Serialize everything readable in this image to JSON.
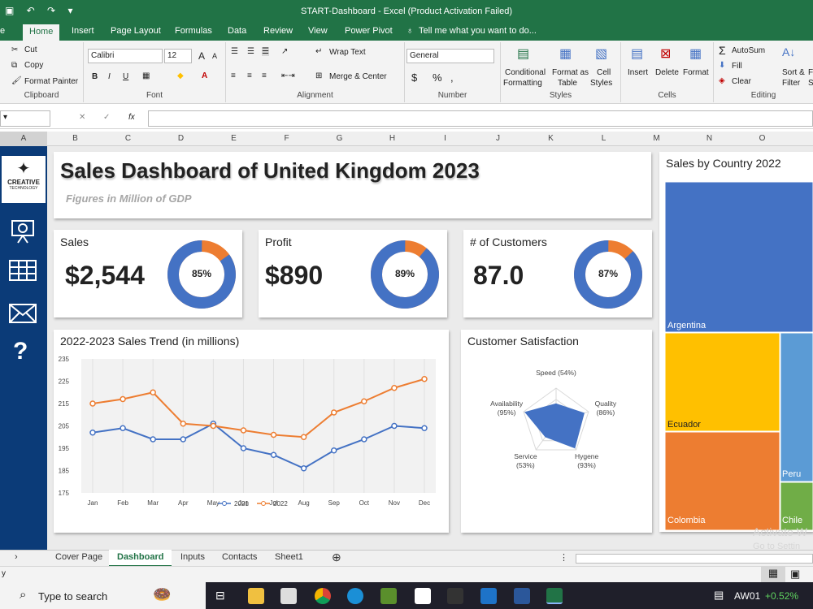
{
  "window": {
    "title": "START-Dashboard - Excel (Product Activation Failed)",
    "file_tab": "e"
  },
  "ribbon_tabs": [
    "Home",
    "Insert",
    "Page Layout",
    "Formulas",
    "Data",
    "Review",
    "View",
    "Power Pivot",
    "Tell me what you want to do..."
  ],
  "clipboard": {
    "cut": "Cut",
    "copy": "Copy",
    "format_painter": "Format Painter",
    "label": "Clipboard"
  },
  "font": {
    "name": "Calibri",
    "size": "12",
    "label": "Font",
    "bold": "B",
    "italic": "I",
    "underline": "U",
    "grow": "A",
    "shrink": "A"
  },
  "alignment": {
    "wrap": "Wrap Text",
    "merge": "Merge & Center",
    "label": "Alignment"
  },
  "number": {
    "format": "General",
    "currency": "$",
    "percent": "%",
    "comma": ",",
    "label": "Number"
  },
  "styles": {
    "conditional": "Conditional",
    "conditional2": "Formatting",
    "format_table": "Format as",
    "format_table2": "Table",
    "cell": "Cell",
    "cell2": "Styles",
    "label": "Styles"
  },
  "cells": {
    "insert": "Insert",
    "delete": "Delete",
    "format": "Format",
    "label": "Cells"
  },
  "editing": {
    "autosum": "AutoSum",
    "fill": "Fill",
    "clear": "Clear",
    "sort": "Sort &",
    "sort2": "Filter",
    "find": "F",
    "find2": "S",
    "label": "Editing"
  },
  "formula_bar": {
    "cancel": "✕",
    "enter": "✓",
    "fx": "fx",
    "value": ""
  },
  "columns": [
    "A",
    "B",
    "C",
    "D",
    "E",
    "F",
    "G",
    "H",
    "I",
    "J",
    "K",
    "L",
    "M",
    "N",
    "O"
  ],
  "logo": {
    "text": "CREATIVE",
    "sub": "TECHNOLOGY"
  },
  "dashboard": {
    "title": "Sales Dashboard of United Kingdom 2023",
    "subtitle": "Figures in Million of GDP"
  },
  "kpis": [
    {
      "label": "Sales",
      "value": "$2,544",
      "pct": "85%",
      "fraction": 0.85
    },
    {
      "label": "Profit",
      "value": "$890",
      "pct": "89%",
      "fraction": 0.89
    },
    {
      "label": "# of Customers",
      "value": "87.0",
      "pct": "87%",
      "fraction": 0.87
    }
  ],
  "colors": {
    "blue": "#4472c4",
    "orange": "#ed7d31",
    "yellow": "#ffc000",
    "sky": "#5b9bd5",
    "green": "#70ad47",
    "navy": "#0b3b78",
    "excel": "#217346"
  },
  "chart_data": [
    {
      "type": "line",
      "title": "2022-2023 Sales Trend (in millions)",
      "categories": [
        "Jan",
        "Feb",
        "Mar",
        "Apr",
        "May",
        "Jun",
        "Jul",
        "Aug",
        "Sep",
        "Oct",
        "Nov",
        "Dec"
      ],
      "series": [
        {
          "name": "2021",
          "values": [
            202,
            204,
            199,
            199,
            206,
            195,
            192,
            186,
            194,
            199,
            205,
            204
          ]
        },
        {
          "name": "2022",
          "values": [
            215,
            217,
            220,
            206,
            205,
            203,
            201,
            200,
            211,
            216,
            222,
            226
          ]
        }
      ],
      "yticks": [
        235,
        225,
        215,
        205,
        195,
        185,
        175
      ],
      "ylim": [
        175,
        235
      ],
      "legend": "bottom"
    },
    {
      "type": "radar",
      "title": "Customer Satisfaction",
      "axes": [
        {
          "label": "Speed (54%)",
          "value": 54
        },
        {
          "label": "Quality (86%)",
          "value": 86
        },
        {
          "label": "Hygene (93%)",
          "value": 93
        },
        {
          "label": "Service (53%)",
          "value": 53
        },
        {
          "label": "Availability (95%)",
          "value": 95
        }
      ]
    },
    {
      "type": "treemap",
      "title": "Sales by Country 2022",
      "labels": [
        "Argentina",
        "Ecuador",
        "Colombia",
        "Peru",
        "Chile"
      ]
    }
  ],
  "sheet_tabs": [
    "Cover Page",
    "Dashboard",
    "Inputs",
    "Contacts",
    "Sheet1"
  ],
  "active_sheet": "Dashboard",
  "watermark": [
    "Activate W",
    "Go to Settin"
  ],
  "status_text": "y",
  "taskbar": {
    "search": "Type to search",
    "stock": "AW01",
    "change": "+0.52%"
  }
}
